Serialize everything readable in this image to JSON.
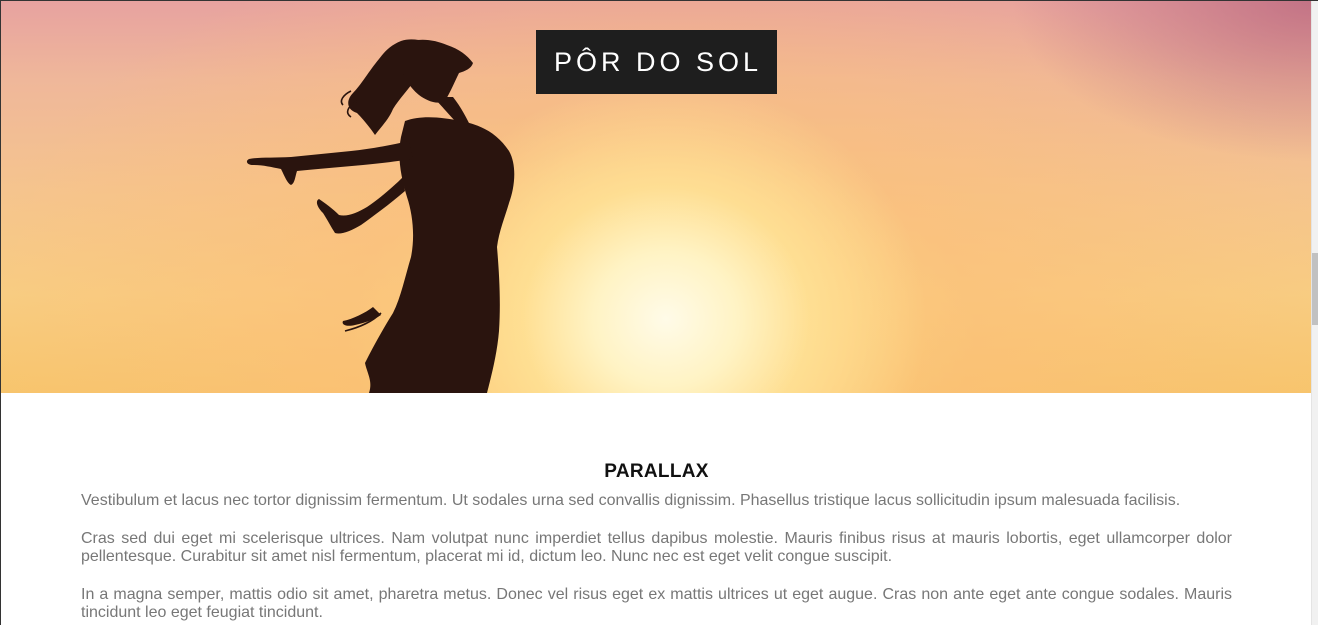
{
  "hero": {
    "title": "PÔR DO SOL"
  },
  "section": {
    "title": "PARALLAX",
    "paragraphs": [
      "Vestibulum et lacus nec tortor dignissim fermentum. Ut sodales urna sed convallis dignissim. Phasellus tristique lacus sollicitudin ipsum malesuada facilisis.",
      "Cras sed dui eget mi scelerisque ultrices. Nam volutpat nunc imperdiet tellus dapibus molestie. Mauris finibus risus at mauris lobortis, eget ullamcorper dolor pellentesque. Curabitur sit amet nisl fermentum, placerat mi id, dictum leo. Nunc nec est eget velit congue suscipit.",
      "In a magna semper, mattis odio sit amet, pharetra metus. Donec vel risus eget ex mattis ultrices ut eget augue. Cras non ante eget ante congue sodales. Mauris tincidunt leo eget feugiat tincidunt."
    ]
  },
  "colors": {
    "title_box_bg": "#1e1e1e",
    "body_text": "#777777",
    "heading_text": "#111111"
  }
}
